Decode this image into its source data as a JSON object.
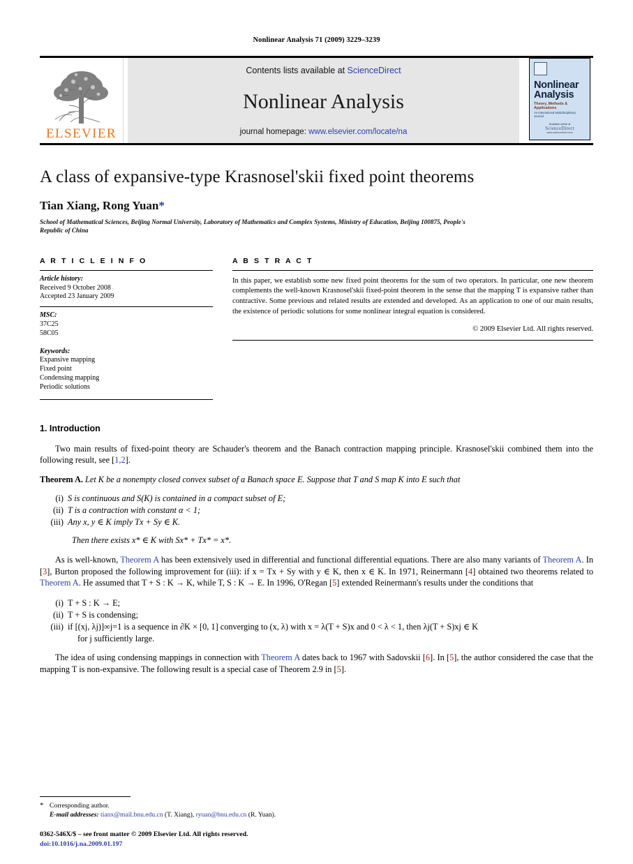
{
  "running_head": "Nonlinear Analysis 71 (2009) 3229–3239",
  "masthead": {
    "publisher_name": "ELSEVIER",
    "contents_prefix": "Contents lists available at ",
    "contents_link": "ScienceDirect",
    "journal_title": "Nonlinear Analysis",
    "homepage_prefix": "journal homepage: ",
    "homepage_url": "www.elsevier.com/locate/na",
    "cover": {
      "title_line1": "Nonlinear",
      "title_line2": "Analysis",
      "subtitle": "Theory, Methods & Applications",
      "subtitle2": "An International Multidisciplinary Journal",
      "footer_small": "Available online at",
      "footer_brand": "ScienceDirect",
      "footer_tiny": "www.sciencedirect.com"
    }
  },
  "article": {
    "title": "A class of expansive-type Krasnosel'skii fixed point theorems",
    "authors": "Tian Xiang, Rong Yuan",
    "corresponding_marker": "*",
    "affiliation": "School of Mathematical Sciences, Beijing Normal University, Laboratory of Mathematics and Complex Systems, Ministry of Education, Beijing 100875, People's Republic of China"
  },
  "article_info": {
    "heading": "A R T I C L E   I N F O",
    "history_label": "Article history:",
    "history": [
      "Received 9 October 2008",
      "Accepted 23 January 2009"
    ],
    "msc_label": "MSC:",
    "msc": [
      "37C25",
      "58C05"
    ],
    "keywords_label": "Keywords:",
    "keywords": [
      "Expansive mapping",
      "Fixed point",
      "Condensing mapping",
      "Periodic solutions"
    ]
  },
  "abstract": {
    "heading": "A B S T R A C T",
    "text": "In this paper, we establish some new fixed point theorems for the sum of two operators. In particular, one new theorem complements the well-known Krasnosel'skii fixed-point theorem in the sense that the mapping T is expansive rather than contractive. Some previous and related results are extended and developed. As an application to one of our main results, the existence of periodic solutions for some nonlinear integral equation is considered.",
    "copyright": "© 2009 Elsevier Ltd. All rights reserved."
  },
  "introduction": {
    "heading": "1. Introduction",
    "para1_a": "Two main results of fixed-point theory are Schauder's theorem and the Banach contraction mapping principle. Krasnosel'skii combined them into the following result, see [",
    "para1_ref": "1,2",
    "para1_b": "].",
    "theorem_a": {
      "name": "Theorem A.",
      "statement": "Let K be a nonempty closed convex subset of a Banach space E. Suppose that T and S map K into E such that",
      "items": [
        {
          "marker": "(i)",
          "text": "S is continuous and S(K) is contained in a compact subset of E;"
        },
        {
          "marker": "(ii)",
          "text": "T is a contraction with constant α < 1;"
        },
        {
          "marker": "(iii)",
          "text": "Any x, y ∈ K imply Tx + Sy ∈ K."
        }
      ],
      "conclusion": "Then there exists x* ∈ K with Sx* + Tx* = x*."
    },
    "para2": {
      "s1": "As is well-known, ",
      "l1": "Theorem A",
      "s2": " has been extensively used in differential and functional differential equations. There are also many variants of ",
      "l2": "Theorem A",
      "s3": ". In [",
      "r1": "3",
      "s4": "], Burton proposed the following improvement for (iii): if x = Tx + Sy with y ∈ K, then x ∈ K. In 1971, Reinermann [",
      "r2": "4",
      "s5": "] obtained two theorems related to ",
      "l3": "Theorem A",
      "s6": ". He assumed that T + S : K → K, while T, S : K → E. In 1996, O'Regan [",
      "r3": "5",
      "s7": "] extended Reinermann's results under the conditions that"
    },
    "oregan_items": [
      {
        "marker": "(i)",
        "text": "T + S : K → E;"
      },
      {
        "marker": "(ii)",
        "text": "T + S is condensing;"
      },
      {
        "marker": "(iii)",
        "text": "if [(xj, λj)]∞j=1 is a sequence in ∂K × [0, 1] converging to (x, λ) with x = λ(T + S)x and 0 < λ < 1, then λj(T + S)xj ∈ K",
        "cont": "for j sufficiently large."
      }
    ],
    "para3": {
      "s1": "The idea of using condensing mappings in connection with ",
      "l1": "Theorem A",
      "s2": " dates back to 1967 with Sadovskii [",
      "r1": "6",
      "s3": "]. In [",
      "r2": "5",
      "s4": "], the author considered the case that the mapping T is non-expansive. The following result is a special case of Theorem 2.9 in [",
      "r3": "5",
      "s5": "]."
    }
  },
  "footnote": {
    "corresponding": "Corresponding author.",
    "email_label": "E-mail addresses:",
    "email1": "tianx@mail.bnu.edu.cn",
    "email1_owner": " (T. Xiang), ",
    "email2": "ryuan@bnu.edu.cn",
    "email2_owner": " (R. Yuan)."
  },
  "bottom": {
    "issn_line": "0362-546X/$ – see front matter © 2009 Elsevier Ltd. All rights reserved.",
    "doi": "doi:10.1016/j.na.2009.01.197"
  },
  "colors": {
    "link_blue": "#2b3ea8",
    "ref_red": "#a32020",
    "elsevier_orange": "#E87722",
    "banner_grey": "#e6e6e6",
    "cover_blue": "#cfe0f2"
  }
}
